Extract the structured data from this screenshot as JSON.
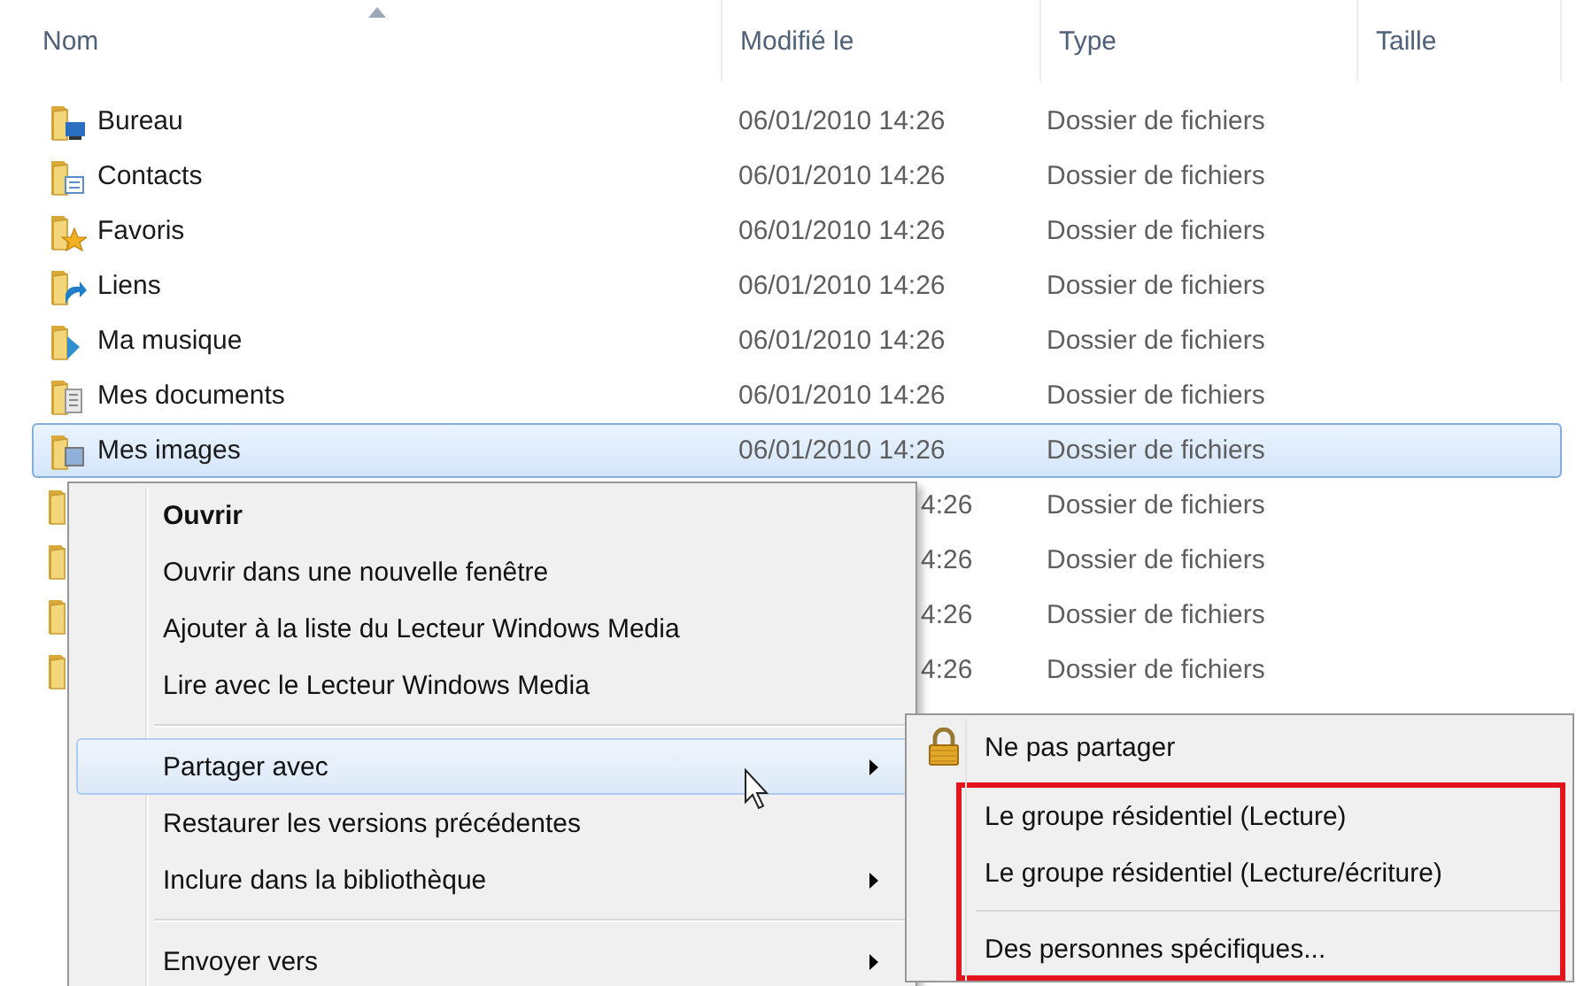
{
  "columns": [
    {
      "label": "Nom",
      "sorted": true
    },
    {
      "label": "Modifié le",
      "sorted": false
    },
    {
      "label": "Type",
      "sorted": false
    },
    {
      "label": "Taille",
      "sorted": false
    }
  ],
  "rows": [
    {
      "kind": "desktop",
      "name": "Bureau",
      "date": "06/01/2010 14:26",
      "type": "Dossier de fichiers",
      "selected": false
    },
    {
      "kind": "contacts",
      "name": "Contacts",
      "date": "06/01/2010 14:26",
      "type": "Dossier de fichiers",
      "selected": false
    },
    {
      "kind": "favorites",
      "name": "Favoris",
      "date": "06/01/2010 14:26",
      "type": "Dossier de fichiers",
      "selected": false
    },
    {
      "kind": "links",
      "name": "Liens",
      "date": "06/01/2010 14:26",
      "type": "Dossier de fichiers",
      "selected": false
    },
    {
      "kind": "music",
      "name": "Ma musique",
      "date": "06/01/2010 14:26",
      "type": "Dossier de fichiers",
      "selected": false
    },
    {
      "kind": "documents",
      "name": "Mes documents",
      "date": "06/01/2010 14:26",
      "type": "Dossier de fichiers",
      "selected": false
    },
    {
      "kind": "pictures",
      "name": "Mes images",
      "date": "06/01/2010 14:26",
      "type": "Dossier de fichiers",
      "selected": true
    },
    {
      "kind": "plain",
      "date": "4:26",
      "type": "Dossier de fichiers",
      "selected": false
    },
    {
      "kind": "plain",
      "date": "4:26",
      "type": "Dossier de fichiers",
      "selected": false
    },
    {
      "kind": "plain",
      "date": "4:26",
      "type": "Dossier de fichiers",
      "selected": false
    },
    {
      "kind": "plain",
      "date": "4:26",
      "type": "Dossier de fichiers",
      "selected": false
    }
  ],
  "context_menu": {
    "items": [
      {
        "kind": "item",
        "label": "Ouvrir",
        "default": true,
        "selected": false,
        "has_submenu": false
      },
      {
        "kind": "item",
        "label": "Ouvrir dans une nouvelle fenêtre",
        "default": false,
        "selected": false,
        "has_submenu": false
      },
      {
        "kind": "item",
        "label": "Ajouter à la liste du Lecteur Windows Media",
        "default": false,
        "selected": false,
        "has_submenu": false
      },
      {
        "kind": "item",
        "label": "Lire avec le Lecteur Windows Media",
        "default": false,
        "selected": false,
        "has_submenu": false
      },
      {
        "kind": "separator"
      },
      {
        "kind": "item",
        "label": "Partager avec",
        "default": false,
        "selected": true,
        "has_submenu": true
      },
      {
        "kind": "item",
        "label": "Restaurer les versions précédentes",
        "default": false,
        "selected": false,
        "has_submenu": false
      },
      {
        "kind": "item",
        "label": "Inclure dans la bibliothèque",
        "default": false,
        "selected": false,
        "has_submenu": true
      },
      {
        "kind": "separator"
      },
      {
        "kind": "item",
        "label": "Envoyer vers",
        "default": false,
        "selected": false,
        "has_submenu": true
      }
    ]
  },
  "submenu": {
    "items": [
      {
        "kind": "lock_item",
        "label": "Ne pas partager"
      }
    ],
    "highlighted_items": [
      {
        "kind": "item",
        "label": "Le groupe résidentiel (Lecture)"
      },
      {
        "kind": "item",
        "label": "Le groupe résidentiel (Lecture/écriture)"
      },
      {
        "kind": "separator"
      },
      {
        "kind": "item",
        "label": "Des personnes spécifiques..."
      }
    ]
  }
}
